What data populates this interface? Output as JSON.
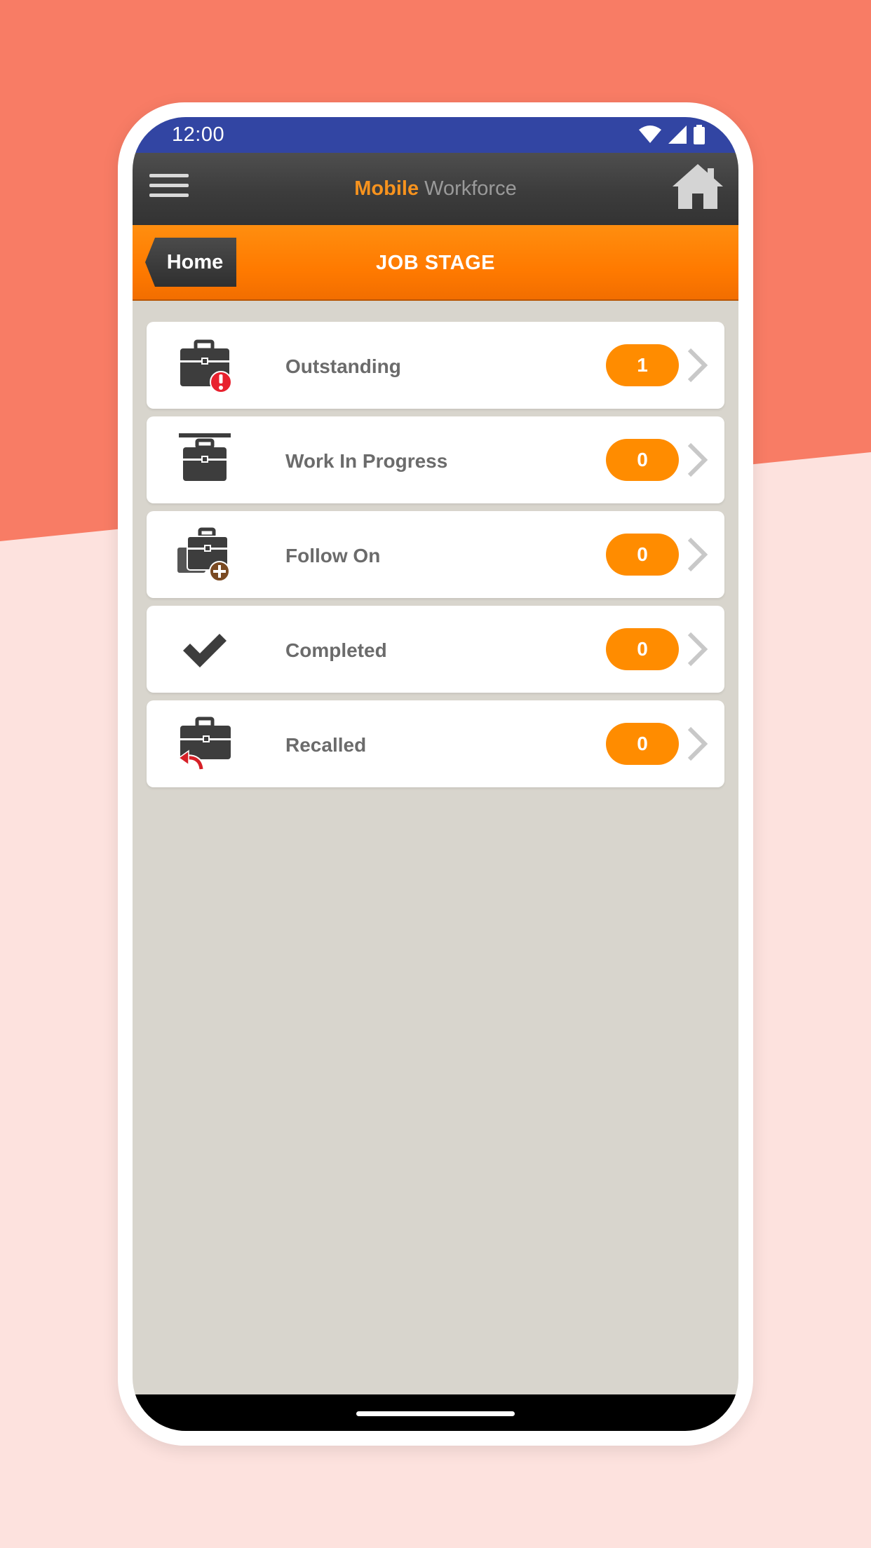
{
  "status_bar": {
    "time": "12:00"
  },
  "top_bar": {
    "title_part1": "Mobile",
    "title_part2": "Workforce"
  },
  "header": {
    "back_label": "Home",
    "title": "JOB STAGE"
  },
  "stages": [
    {
      "label": "Outstanding",
      "count": "1",
      "icon": "briefcase-alert-icon"
    },
    {
      "label": "Work In Progress",
      "count": "0",
      "icon": "briefcase-progress-icon"
    },
    {
      "label": "Follow On",
      "count": "0",
      "icon": "briefcase-add-icon"
    },
    {
      "label": "Completed",
      "count": "0",
      "icon": "checkmark-icon"
    },
    {
      "label": "Recalled",
      "count": "0",
      "icon": "briefcase-recall-icon"
    }
  ],
  "colors": {
    "accent": "#ff8c00",
    "status_bar": "#3245a3",
    "top_bar": "#3c3c3c",
    "alert": "#e8212e",
    "recall": "#d62027",
    "add_badge": "#7a4a22"
  }
}
